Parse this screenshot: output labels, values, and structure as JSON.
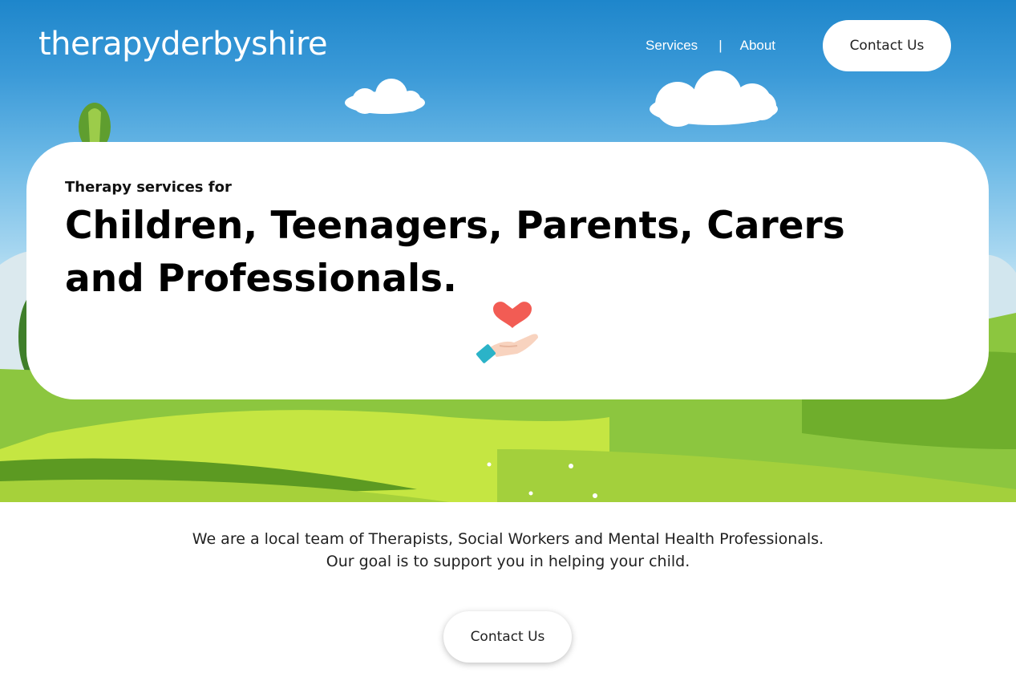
{
  "brand": {
    "logo_text": "therapyderbyshire"
  },
  "nav": {
    "items": [
      {
        "label": "Services"
      },
      {
        "label": "About"
      }
    ],
    "separator": "|",
    "cta_label": "Contact Us"
  },
  "hero": {
    "kicker": "Therapy services for",
    "headline": "Children, Teenagers, Parents, Carers and Professionals.",
    "icon": "heart-in-hand-icon"
  },
  "intro": {
    "line1": "We are a local team of Therapists, Social Workers and Mental Health Professionals.",
    "line2": "Our goal is to support you in helping your child."
  },
  "cta": {
    "label": "Contact Us"
  },
  "colors": {
    "sky_top": "#1e86cb",
    "grass": "#8cc63f",
    "heart": "#f25c54",
    "cuff": "#2bb3c8"
  }
}
